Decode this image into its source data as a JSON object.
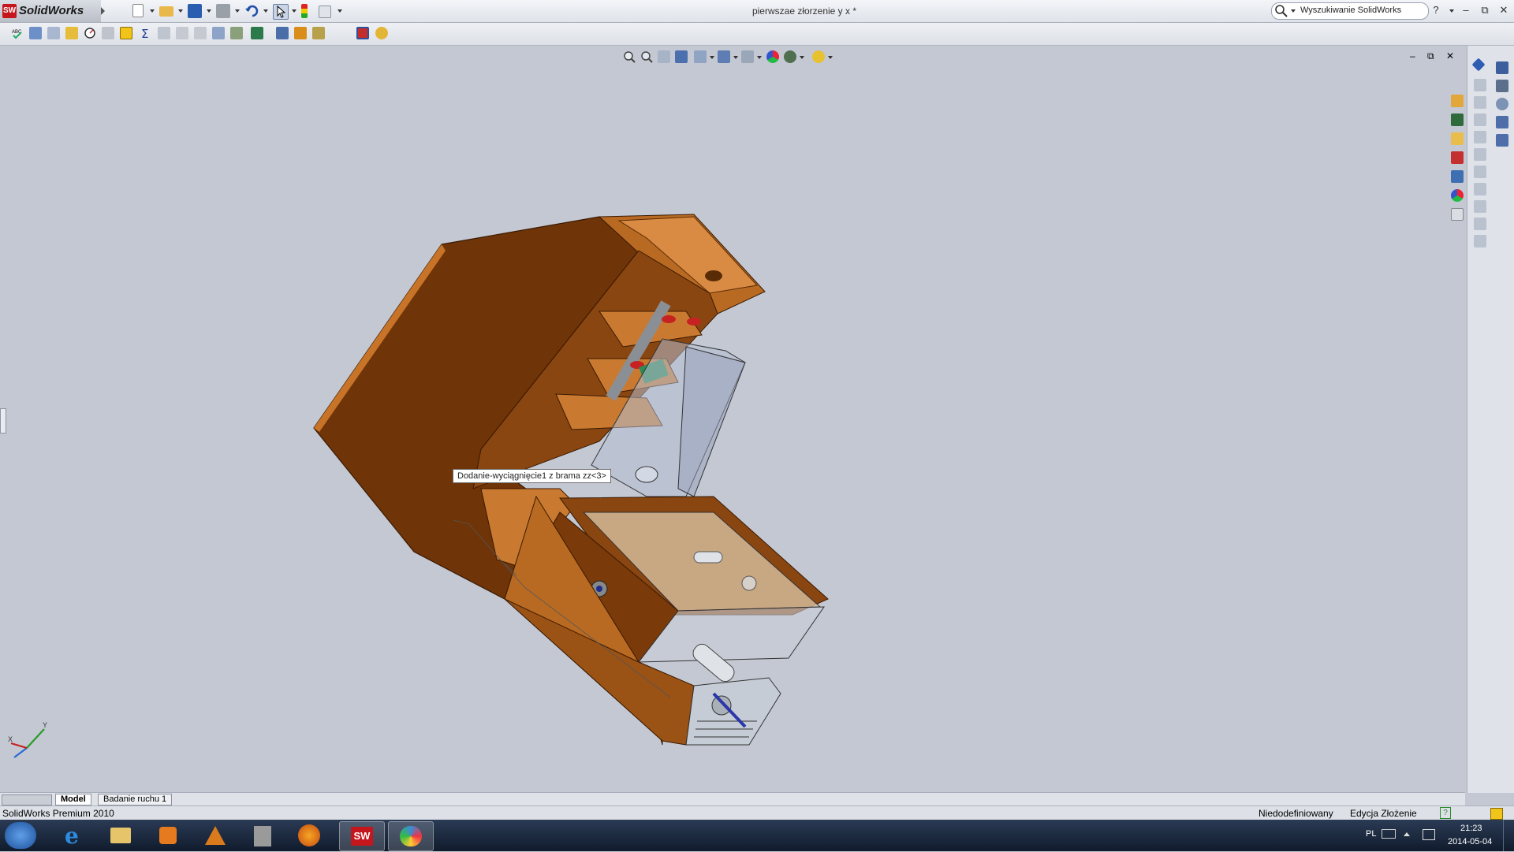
{
  "app": {
    "name": "SolidWorks",
    "document_title": "pierwszae złorzenie y x *"
  },
  "search": {
    "label": "Wyszukiwanie SolidWorks"
  },
  "window_controls": {
    "help": "?",
    "minimize": "–",
    "restore": "⧉",
    "close": "✕"
  },
  "viewport": {
    "tooltip": "Dodanie-wyciągnięcie1 z brama zz<3>",
    "triad": {
      "x": "X",
      "y": "Y"
    },
    "controls": {
      "minimize": "–",
      "restore": "⧉",
      "close": "✕"
    }
  },
  "tabs": [
    {
      "label": "Model",
      "active": true
    },
    {
      "label": "Badanie ruchu 1",
      "active": false
    }
  ],
  "status": {
    "product": "SolidWorks Premium 2010",
    "definition": "Niedodefiniowany",
    "mode": "Edycja Złożenie",
    "help": "?"
  },
  "taskbar": {
    "language": "PL",
    "time": "21:23",
    "date": "2014-05-04",
    "apps": [
      "start",
      "internet-explorer",
      "file-explorer",
      "media-player",
      "matlab",
      "notepad",
      "firefox",
      "solidworks",
      "paint"
    ]
  },
  "colors": {
    "accent": "#c4161c",
    "model_orange": "#b8651e",
    "model_dark": "#6e3306",
    "viewport_bg": "#c3c8d2"
  }
}
